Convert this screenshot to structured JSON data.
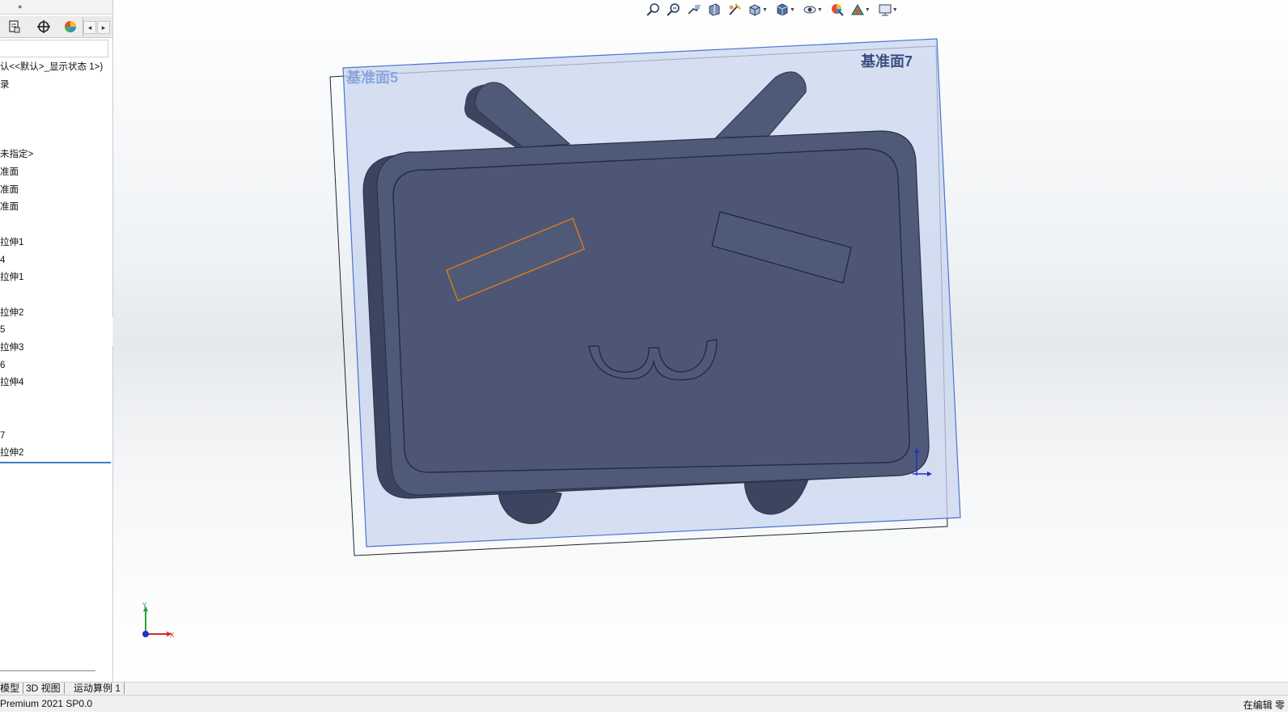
{
  "feature_tree": {
    "config_line": "认<<默认>_显示状态 1>)",
    "items": [
      {
        "label": "录"
      },
      {
        "label": "未指定>"
      },
      {
        "label": "准面"
      },
      {
        "label": "准面"
      },
      {
        "label": "准面"
      },
      {
        "label": "拉伸1"
      },
      {
        "label": "4"
      },
      {
        "label": "拉伸1"
      },
      {
        "label": "拉伸2"
      },
      {
        "label": "5"
      },
      {
        "label": "拉伸3"
      },
      {
        "label": "6"
      },
      {
        "label": "拉伸4"
      },
      {
        "label": "7"
      },
      {
        "label": "拉伸2"
      }
    ]
  },
  "panel_tabs": [
    {
      "icon": "property-manager-icon"
    },
    {
      "icon": "configuration-manager-icon"
    },
    {
      "icon": "display-manager-icon"
    }
  ],
  "heads_up_toolbar": [
    {
      "icon": "zoom-to-fit-icon"
    },
    {
      "icon": "zoom-to-area-icon"
    },
    {
      "icon": "previous-view-icon"
    },
    {
      "icon": "section-view-icon"
    },
    {
      "icon": "dynamic-annotation-icon"
    },
    {
      "icon": "view-orientation-icon"
    },
    {
      "icon": "display-style-icon"
    },
    {
      "icon": "hide-show-items-icon"
    },
    {
      "icon": "edit-appearance-icon"
    },
    {
      "icon": "apply-scene-icon"
    },
    {
      "icon": "view-settings-icon"
    }
  ],
  "viewport": {
    "plane_labels": {
      "back_plane": "基准面5",
      "front_plane": "基准面7"
    },
    "triad": {
      "y_label": "Y",
      "x_label": "X"
    }
  },
  "bottom_tabs": [
    "模型",
    "3D 视图",
    "运动算例 1"
  ],
  "status": {
    "left": "Premium 2021 SP0.0",
    "right": "在编辑 零"
  },
  "colors": {
    "model_face": "#4f5a78",
    "model_side": "#3b4560",
    "plane_fill": "#c9d6ef",
    "plane_edge": "#4a73d4",
    "selection_edge": "#e07a18",
    "accent_line": "#3d7fc6"
  }
}
